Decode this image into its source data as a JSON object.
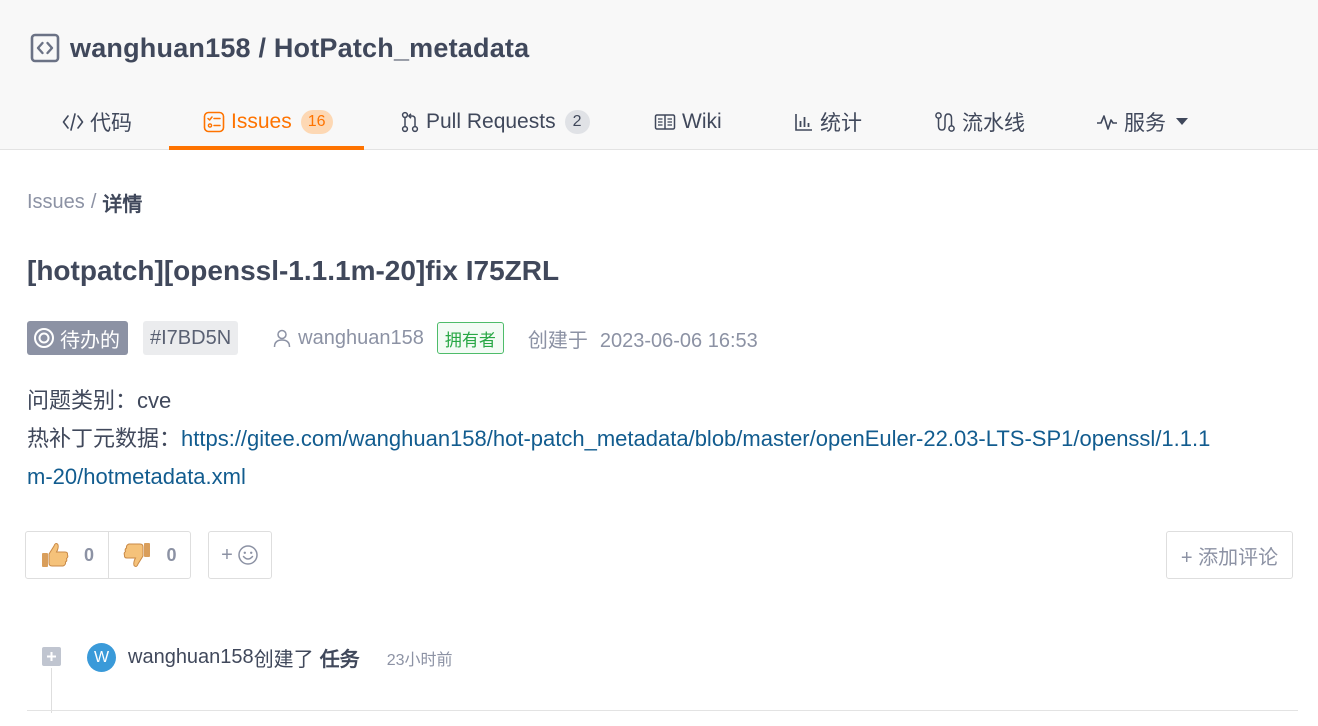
{
  "repo": {
    "title": "wanghuan158 / HotPatch_metadata",
    "icon": "code-repo-icon"
  },
  "tabs": [
    {
      "label": "代码",
      "icon": "code-icon"
    },
    {
      "label": "Issues",
      "icon": "issues-icon",
      "count": "16",
      "active": true
    },
    {
      "label": "Pull Requests",
      "icon": "pull-request-icon",
      "count": "2"
    },
    {
      "label": "Wiki",
      "icon": "book-icon"
    },
    {
      "label": "统计",
      "icon": "stats-icon"
    },
    {
      "label": "流水线",
      "icon": "pipeline-icon"
    },
    {
      "label": "服务",
      "icon": "pulse-icon",
      "dropdown": true
    }
  ],
  "breadcrumb": {
    "root": "Issues",
    "sep": "/",
    "current": "详情"
  },
  "issue": {
    "title": "[hotpatch][openssl-1.1.1m-20]fix I75ZRL",
    "state": "待办的",
    "ident": "#I7BD5N",
    "author": "wanghuan158",
    "owner_badge": "拥有者",
    "created_label": "创建于",
    "created_time": "2023-06-06 16:53",
    "body": {
      "type_label": "问题类别：",
      "type_value": "cve",
      "meta_label": "热补丁元数据：",
      "meta_link": "https://gitee.com/wanghuan158/hot-patch_metadata/blob/master/openEuler-22.03-LTS-SP1/openssl/1.1.1m-20/hotmetadata.xml"
    }
  },
  "reactions": {
    "thumbs_up_count": "0",
    "thumbs_down_count": "0",
    "add_reaction_plus": "+",
    "add_comment": "+ 添加评论"
  },
  "timeline": {
    "avatar_letter": "W",
    "actor": "wanghuan158",
    "action": "创建了",
    "object": "任务",
    "ago": "23小时前"
  },
  "colors": {
    "accent": "#fe7300",
    "link": "#125c8f",
    "owner_green": "#28a745",
    "state_gray": "#8c92a4",
    "avatar_blue": "#3a9ad9"
  }
}
